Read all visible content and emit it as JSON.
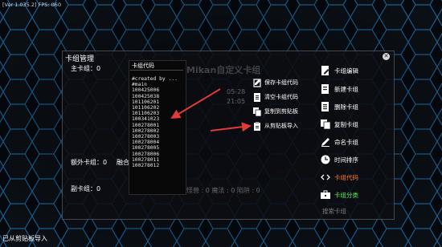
{
  "hud": {
    "version": "[Ver 1.035.2] FPS: 060"
  },
  "dialog": {
    "title": "卡组管理",
    "close_glyph": "✕",
    "main_deck_label": "主卡组：0",
    "extra_deck_label": "额外卡组：0",
    "fusion_label": "融合",
    "side_deck_label": "副卡组：0",
    "bg_ghost_title": "Mikan自定义卡组",
    "bg_ghost_date1": "05-28",
    "bg_ghost_date2": "21:05",
    "bg_ghost_row": "怪兽 : 0 魔法 : 0 陷阱 : 0"
  },
  "code_panel": {
    "title": "卡组代码",
    "lines": "#created by ...\n#main\n100425006\n100425038\n101106201\n101106202\n101106203\n100341023\n100278001\n100278002\n100278003\n100278004\n100278005\n100278006\n100278011\n100278012"
  },
  "code_actions": [
    {
      "label": "保存卡组代码",
      "icon": "save-icon"
    },
    {
      "label": "清空卡组代码",
      "icon": "clear-icon"
    },
    {
      "label": "复制到剪贴板",
      "icon": "copy-icon"
    },
    {
      "label": "从剪贴板导入",
      "icon": "paste-icon"
    }
  ],
  "side_menu": [
    {
      "label": "卡组编辑",
      "icon": "edit-doc-icon",
      "color": "#ffffff"
    },
    {
      "label": "新建卡组",
      "icon": "new-doc-icon",
      "color": "#ffffff"
    },
    {
      "label": "删除卡组",
      "icon": "delete-doc-icon",
      "color": "#ffffff"
    },
    {
      "label": "复制卡组",
      "icon": "copy-deck-icon",
      "color": "#ffffff"
    },
    {
      "label": "命名卡组",
      "icon": "pencil-icon",
      "color": "#ffffff"
    },
    {
      "label": "时间排序",
      "icon": "clock-icon",
      "color": "#ffffff"
    },
    {
      "label": "卡组代码",
      "icon": "code-icon",
      "color": "#ff7a1a"
    },
    {
      "label": "卡组分类",
      "icon": "briefcase-icon",
      "color": "#5cf05c"
    },
    {
      "label": "搜索卡组",
      "icon": "",
      "color": "#7a7a7a"
    }
  ],
  "status": {
    "toast": "已从剪贴板导入"
  },
  "colors": {
    "accent_orange": "#ff7a1a",
    "accent_green": "#5cf05c",
    "arrow_red": "#e03a3a"
  }
}
